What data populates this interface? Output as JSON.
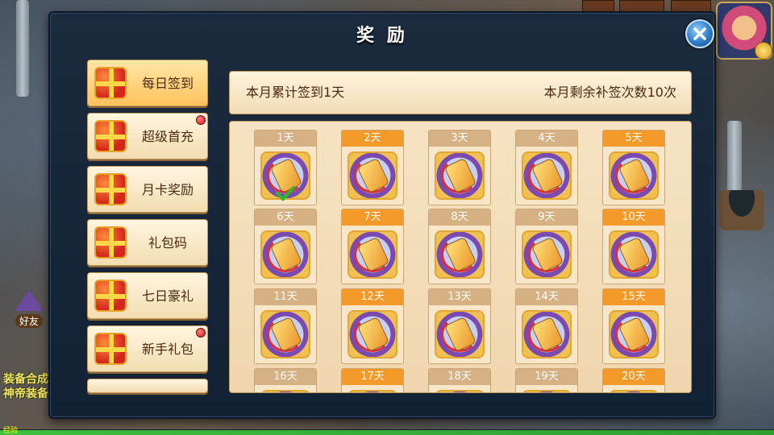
{
  "dialog": {
    "title": "奖 励",
    "close_icon": "close-x-icon"
  },
  "menu": [
    {
      "label": "每日签到",
      "active": true,
      "badge": false
    },
    {
      "label": "超级首充",
      "active": false,
      "badge": true
    },
    {
      "label": "月卡奖励",
      "active": false,
      "badge": false
    },
    {
      "label": "礼包码",
      "active": false,
      "badge": false
    },
    {
      "label": "七日豪礼",
      "active": false,
      "badge": false
    },
    {
      "label": "新手礼包",
      "active": false,
      "badge": true
    }
  ],
  "info": {
    "cumulative": "本月累计签到1天",
    "remaining": "本月剩余补签次数10次"
  },
  "days": [
    {
      "label": "1天",
      "style": "tan",
      "checked": true
    },
    {
      "label": "2天",
      "style": "orange",
      "checked": false
    },
    {
      "label": "3天",
      "style": "tan",
      "checked": false
    },
    {
      "label": "4天",
      "style": "tan",
      "checked": false
    },
    {
      "label": "5天",
      "style": "orange",
      "checked": false
    },
    {
      "label": "6天",
      "style": "tan",
      "checked": false
    },
    {
      "label": "7天",
      "style": "orange",
      "checked": false
    },
    {
      "label": "8天",
      "style": "tan",
      "checked": false
    },
    {
      "label": "9天",
      "style": "tan",
      "checked": false
    },
    {
      "label": "10天",
      "style": "orange",
      "checked": false
    },
    {
      "label": "11天",
      "style": "tan",
      "checked": false
    },
    {
      "label": "12天",
      "style": "orange",
      "checked": false
    },
    {
      "label": "13天",
      "style": "tan",
      "checked": false
    },
    {
      "label": "14天",
      "style": "tan",
      "checked": false
    },
    {
      "label": "15天",
      "style": "orange",
      "checked": false
    },
    {
      "label": "16天",
      "style": "tan",
      "checked": false
    },
    {
      "label": "17天",
      "style": "orange",
      "checked": false
    },
    {
      "label": "18天",
      "style": "tan",
      "checked": false
    },
    {
      "label": "19天",
      "style": "tan",
      "checked": false
    },
    {
      "label": "20天",
      "style": "orange",
      "checked": false
    }
  ],
  "background": {
    "friend_label": "好友",
    "side_text_1": "装备合成",
    "side_text_2": "神帝装备",
    "exp_label": "经验"
  },
  "colors": {
    "accent_orange": "#f39a2a",
    "panel_tan": "#f6e3c3",
    "dialog_navy": "#1b2a3d"
  }
}
